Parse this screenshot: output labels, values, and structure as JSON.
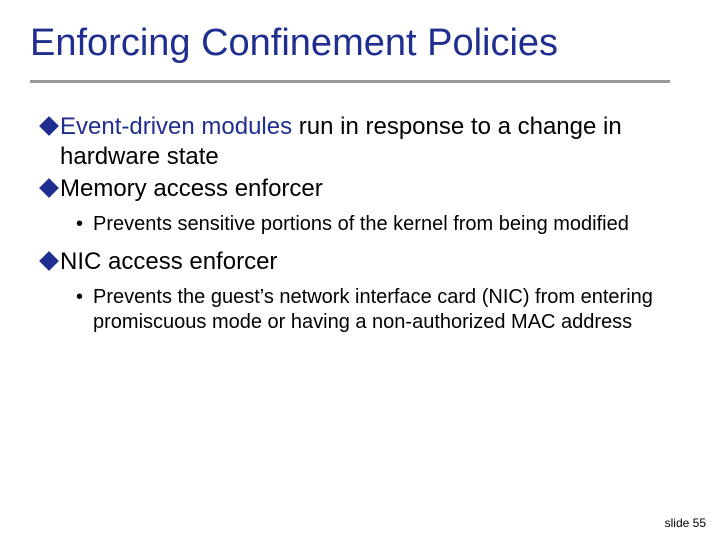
{
  "title": "Enforcing Confinement Policies",
  "items": [
    {
      "level": 1,
      "segments": [
        {
          "text": "Event-driven modules",
          "accent": true
        },
        {
          "text": " run in response to a change in hardware state",
          "accent": false
        }
      ]
    },
    {
      "level": 1,
      "segments": [
        {
          "text": "Memory access enforcer",
          "accent": false
        }
      ]
    },
    {
      "level": 2,
      "text": "Prevents sensitive portions of the kernel from being modified"
    },
    {
      "level": 1,
      "segments": [
        {
          "text": "NIC access enforcer",
          "accent": false
        }
      ]
    },
    {
      "level": 2,
      "text": "Prevents the guest’s network interface card (NIC) from entering promiscuous mode or having a non-authorized MAC address"
    }
  ],
  "footer": "slide 55"
}
